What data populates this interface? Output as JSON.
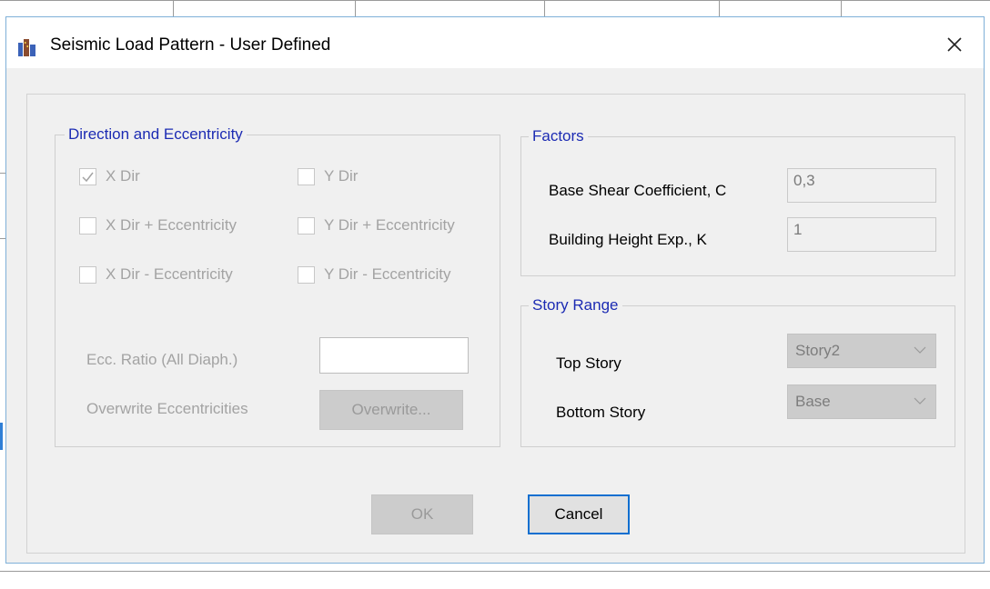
{
  "window": {
    "title": "Seismic Load Pattern - User Defined",
    "close_glyph": "X",
    "app_icon": "etabs-building-icon",
    "close_icon": "close-icon"
  },
  "direction_group": {
    "title": "Direction and Eccentricity",
    "checkboxes": [
      {
        "label": "X Dir",
        "checked": true
      },
      {
        "label": "Y Dir",
        "checked": false
      },
      {
        "label": "X Dir + Eccentricity",
        "checked": false
      },
      {
        "label": "Y Dir + Eccentricity",
        "checked": false
      },
      {
        "label": "X Dir - Eccentricity",
        "checked": false
      },
      {
        "label": "Y Dir - Eccentricity",
        "checked": false
      }
    ],
    "ecc_ratio_label": "Ecc. Ratio (All Diaph.)",
    "ecc_ratio_value": "",
    "overwrite_label": "Overwrite Eccentricities",
    "overwrite_button": "Overwrite..."
  },
  "factors_group": {
    "title": "Factors",
    "base_shear_label": "Base Shear Coefficient, C",
    "base_shear_value": "0,3",
    "height_exp_label": "Building Height Exp., K",
    "height_exp_value": "1"
  },
  "story_range_group": {
    "title": "Story Range",
    "top_story_label": "Top Story",
    "top_story_value": "Story2",
    "bottom_story_label": "Bottom Story",
    "bottom_story_value": "Base"
  },
  "buttons": {
    "ok": "OK",
    "cancel": "Cancel"
  },
  "colors": {
    "group_title": "#1c2bb3",
    "focus_border": "#0f6fd0",
    "dialog_bg": "#f0f0f0"
  }
}
